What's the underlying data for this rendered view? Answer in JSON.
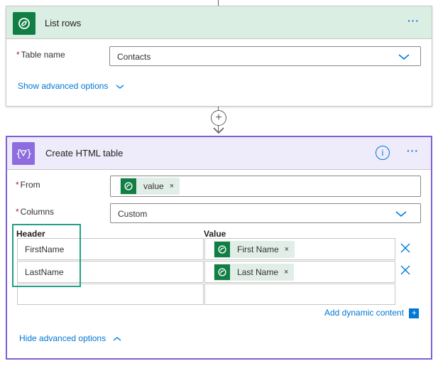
{
  "list_rows": {
    "title": "List rows",
    "more_menu": "···",
    "table_name_label": "Table name",
    "table_name_value": "Contacts",
    "show_advanced": "Show advanced options"
  },
  "connector": {
    "add_label": "+"
  },
  "html_table": {
    "title": "Create HTML table",
    "more_menu": "···",
    "info": "i",
    "from_label": "From",
    "from_token": "value",
    "columns_label": "Columns",
    "columns_value": "Custom",
    "header_col": "Header",
    "value_col": "Value",
    "rows": [
      {
        "header": "FirstName",
        "value": "First Name"
      },
      {
        "header": "LastName",
        "value": "Last Name"
      }
    ],
    "token_remove": "×",
    "add_dynamic": "Add dynamic content",
    "hide_advanced": "Hide advanced options"
  },
  "colors": {
    "dataverse_green": "#117e44",
    "list_header_bg": "#dbeee4",
    "html_header_bg": "#eeebfa",
    "html_accent": "#7e5fd4",
    "link_blue": "#0078d4",
    "highlight_teal": "#23a086"
  }
}
